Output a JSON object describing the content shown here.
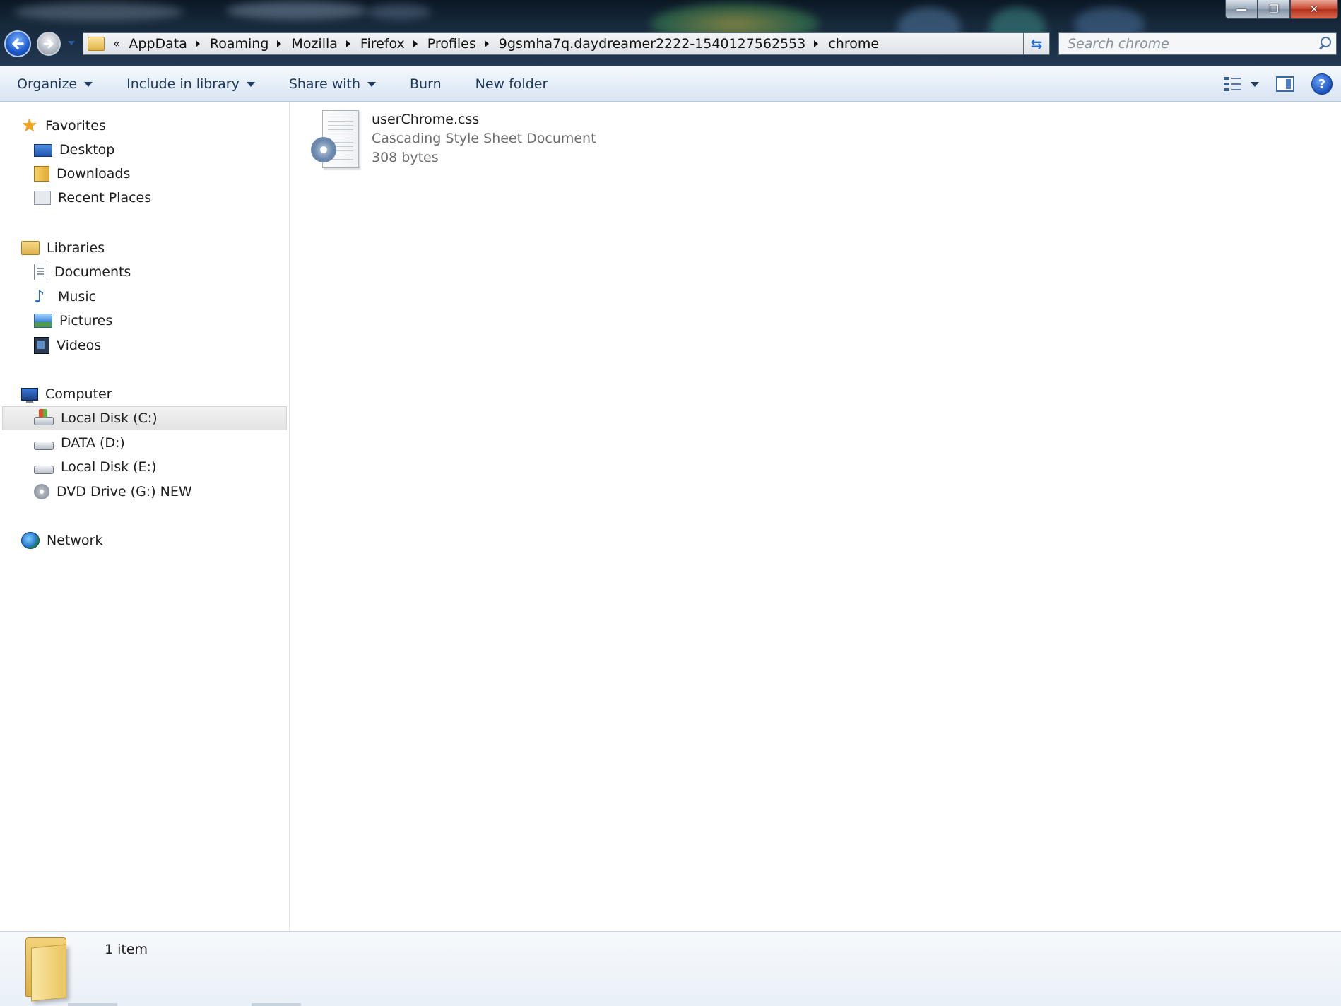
{
  "window": {
    "controls": {
      "minimize": "—",
      "restore": "❐",
      "close": "✕"
    }
  },
  "address_bar": {
    "overflow": "«",
    "crumbs": [
      "AppData",
      "Roaming",
      "Mozilla",
      "Firefox",
      "Profiles",
      "9gsmha7q.daydreamer2222-1540127562553",
      "chrome"
    ]
  },
  "search": {
    "placeholder": "Search chrome"
  },
  "toolbar": {
    "organize": "Organize",
    "include_in_library": "Include in library",
    "share_with": "Share with",
    "burn": "Burn",
    "new_folder": "New folder",
    "help": "?"
  },
  "nav": {
    "favorites": {
      "label": "Favorites",
      "items": [
        "Desktop",
        "Downloads",
        "Recent Places"
      ]
    },
    "libraries": {
      "label": "Libraries",
      "items": [
        "Documents",
        "Music",
        "Pictures",
        "Videos"
      ]
    },
    "computer": {
      "label": "Computer",
      "items": [
        "Local Disk (C:)",
        "DATA (D:)",
        "Local Disk (E:)",
        "DVD Drive (G:) NEW"
      ],
      "selected": "Local Disk (C:)"
    },
    "network": {
      "label": "Network"
    }
  },
  "files": [
    {
      "name": "userChrome.css",
      "type": "Cascading Style Sheet Document",
      "size": "308 bytes",
      "icon": "css-document-icon"
    }
  ],
  "details": {
    "item_count": "1 item"
  },
  "colors": {
    "command_bar": "#dde8f4",
    "selection": "#e6e6e6",
    "text_secondary": "#6d6d6d",
    "link_text": "#1e395b"
  }
}
